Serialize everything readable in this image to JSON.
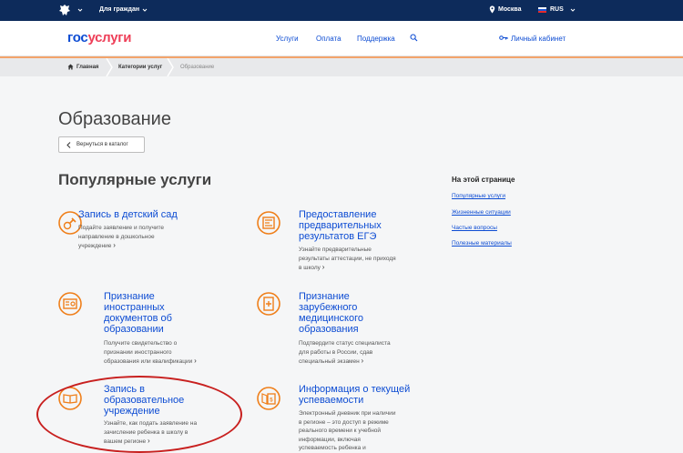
{
  "topbar": {
    "citizens": "Для граждан",
    "city": "Москва",
    "lang": "RUS"
  },
  "header": {
    "logo_part1": "гос",
    "logo_part2": "услуги",
    "nav": [
      "Услуги",
      "Оплата",
      "Поддержка"
    ],
    "cabinet": "Личный кабинет"
  },
  "breadcrumbs": {
    "home": "Главная",
    "categories": "Категории услуг",
    "current": "Образование"
  },
  "page": {
    "title": "Образование",
    "back": "Вернуться в каталог",
    "popular": "Популярные услуги"
  },
  "services": [
    {
      "title": [
        "Запись в детский сад"
      ],
      "desc": [
        "Подайте заявление и получите",
        "направление в дошкольное",
        "учреждение"
      ],
      "icon": "pacifier-icon"
    },
    {
      "title": [
        "Предоставление",
        "предварительных",
        "результатов ЕГЭ"
      ],
      "desc": [
        "Узнайте предварительные",
        "результаты аттестации, не приходя",
        "в школу"
      ],
      "icon": "exam-results-icon"
    },
    {
      "title": [
        "Признание",
        "иностранных",
        "документов об",
        "образовании"
      ],
      "desc": [
        "Получите свидетельство о",
        "признании иностранного",
        "образования или квалификации"
      ],
      "icon": "diploma-icon"
    },
    {
      "title": [
        "Признание",
        "зарубежного",
        "медицинского",
        "образования"
      ],
      "desc": [
        "Подтвердите статус специалиста",
        "для работы в России, сдав",
        "специальный экзамен"
      ],
      "icon": "medical-book-icon"
    },
    {
      "title": [
        "Запись в",
        "образовательное",
        "учреждение"
      ],
      "desc": [
        "Узнайте, как подать заявление на",
        "зачисление ребенка в школу в",
        "вашем регионе"
      ],
      "icon": "open-book-icon"
    },
    {
      "title": [
        "Информация о текущей",
        "успеваемости"
      ],
      "desc": [
        "Электронный дневник при наличии",
        "в регионе – это доступ в режиме",
        "реального времени к учебной",
        "информации, включая",
        "успеваемость ребенка и"
      ],
      "icon": "diary-icon"
    }
  ],
  "aside": {
    "title": "На этой странице",
    "links": [
      "Популярные услуги",
      "Жизненные ситуации",
      "Частые вопросы",
      "Полезные материалы"
    ]
  },
  "colors": {
    "brand_blue": "#0d4cd3",
    "brand_red": "#ee3f58",
    "topbar": "#0d2b5b",
    "accent_orange": "#ef7f1a",
    "highlight_oval": "#c8201f"
  }
}
